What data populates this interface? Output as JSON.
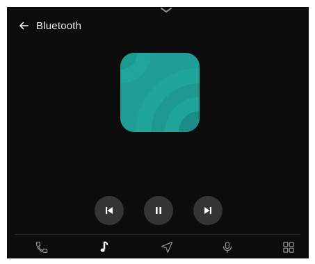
{
  "header": {
    "title": "Bluetooth",
    "back_icon": "arrow-left-icon"
  },
  "drawer_handle_icon": "chevron-down-icon",
  "album_art": {
    "colors": [
      "#1f9e95",
      "#23aca2",
      "#1b8f87",
      "#178079"
    ]
  },
  "playback": {
    "state": "playing",
    "controls": [
      {
        "id": "previous",
        "icon": "skip-previous-icon"
      },
      {
        "id": "play_pause",
        "icon": "pause-icon"
      },
      {
        "id": "next",
        "icon": "skip-next-icon"
      }
    ]
  },
  "nav": {
    "items": [
      {
        "id": "phone",
        "icon": "phone-icon",
        "active": false
      },
      {
        "id": "media",
        "icon": "music-note-icon",
        "active": true
      },
      {
        "id": "navigation",
        "icon": "navigation-arrow-icon",
        "active": false
      },
      {
        "id": "assistant",
        "icon": "microphone-icon",
        "active": false
      },
      {
        "id": "apps",
        "icon": "app-grid-icon",
        "active": false
      }
    ]
  },
  "colors": {
    "background": "#0c0c0c",
    "control_button": "#353535",
    "active_icon": "#ffffff",
    "inactive_icon": "#8a8a8a",
    "accent": "#1f9e95"
  }
}
